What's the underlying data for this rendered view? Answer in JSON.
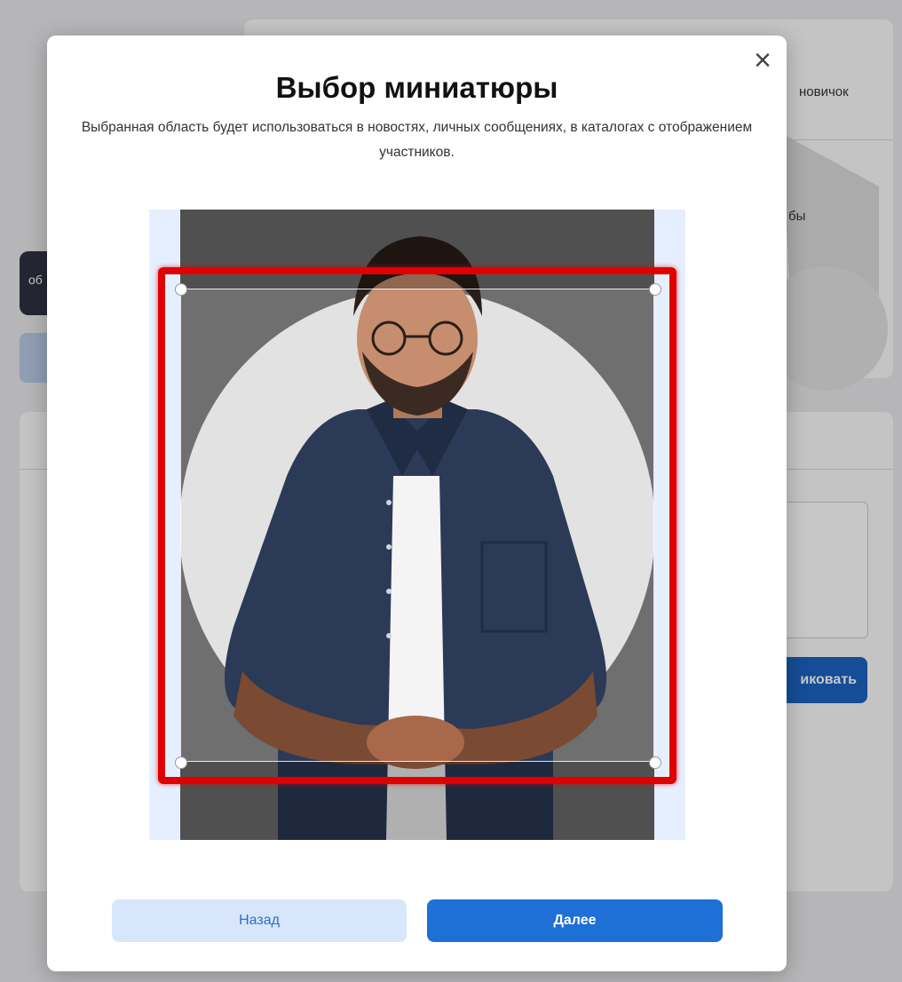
{
  "background": {
    "top_right_text": "новичок",
    "right_fragment": "бы",
    "left_button_fragment": "об",
    "publish_button_fragment": "иковать"
  },
  "modal": {
    "title": "Выбор миниатюры",
    "subtitle": "Выбранная область будет использоваться в новостях, личных сообщениях, в каталогах с отображением участников.",
    "close_label": "×",
    "back_label": "Назад",
    "next_label": "Далее"
  },
  "colors": {
    "accent": "#1e6fd6",
    "back_button_bg": "#d8e6fb",
    "highlight": "#e00000"
  },
  "icons": {
    "close": "close-icon",
    "photo": "person-portrait-image"
  }
}
